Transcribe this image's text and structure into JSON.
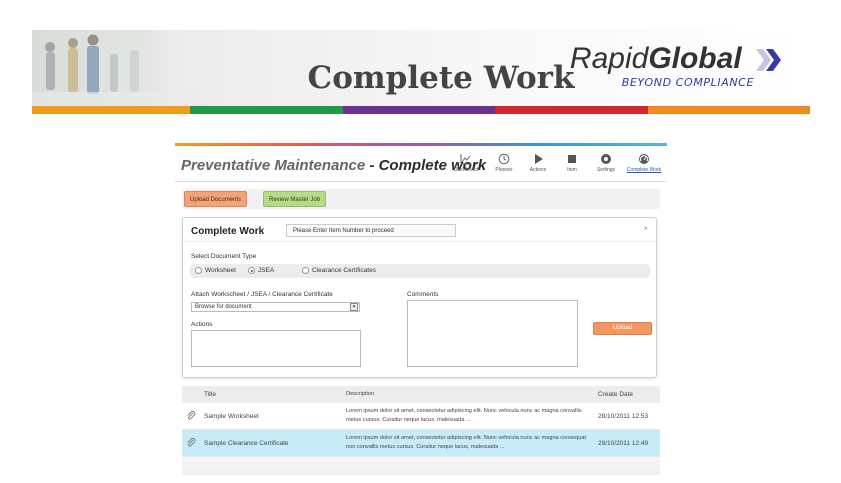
{
  "slide": {
    "title": "Complete Work",
    "logo_rapid": "Rapid",
    "logo_global": "Global",
    "logo_tagline": "BEYOND COMPLIANCE",
    "color_bar": [
      "#f39b1e",
      "#1f9a48",
      "#6c2f97",
      "#d1272f",
      "#f08a1e"
    ]
  },
  "app": {
    "title_prefix": "Preventative Maintenance",
    "title_sep": " - ",
    "title_main": "Complete work",
    "nav": [
      {
        "label": "Dashboard",
        "icon": "chart-icon"
      },
      {
        "label": "Planner",
        "icon": "clock-icon"
      },
      {
        "label": "Actions",
        "icon": "play-icon"
      },
      {
        "label": "Item",
        "icon": "stop-icon"
      },
      {
        "label": "Settings",
        "icon": "gear-icon"
      },
      {
        "label": "Complete Work",
        "icon": "gauge-icon",
        "active": true
      }
    ],
    "buttons": {
      "upload_documents": "Upload Documents",
      "review_master_job": "Review Master Job"
    }
  },
  "panel": {
    "title": "Complete Work",
    "prompt": "Please Enter Item Number to proceed",
    "close": "×",
    "select_doc_type_label": "Select Document Type",
    "doc_types": [
      {
        "label": "Worksheet",
        "selected": false
      },
      {
        "label": "JSEA",
        "selected": true
      },
      {
        "label": "Clearance Certificates",
        "selected": false
      }
    ],
    "attach_label": "Attach Workscheet / JSEA / Clearance Certificate",
    "browse_value": "Browse for document",
    "actions_label": "Actions",
    "comments_label": "Comments",
    "upload_button": "Upload"
  },
  "table": {
    "columns": [
      "Title",
      "Description",
      "Create Date"
    ],
    "rows": [
      {
        "title": "Sample Worksheet",
        "description": "Lorem ipsum dolor sit amet, consectetur adipiscing elit. Nunc vehicula nunc ac magna convallis metus cursus. Curaitur neque lacus, malesuada ...",
        "date": "28/10/2011 12:53",
        "selected": false
      },
      {
        "title": "Sample Clearance Certificate",
        "description": "Lorem ipsum dolor sit amet, consectetur adipiscing elit. Nunc vehicula nunc ac magna consequat non convallis metus cursus. Curaitur neque lacus, malesuada ...",
        "date": "28/10/2011 12:49",
        "selected": true
      }
    ]
  }
}
